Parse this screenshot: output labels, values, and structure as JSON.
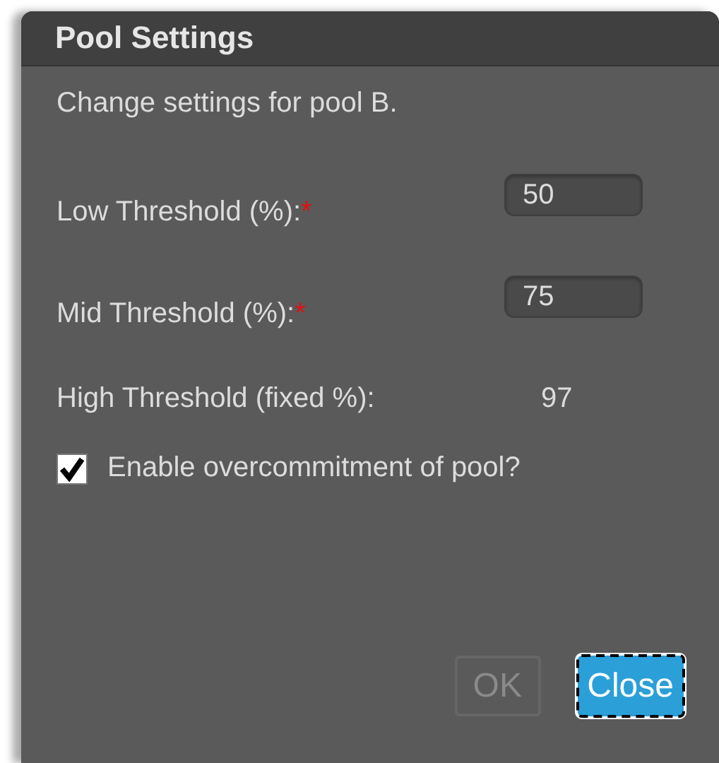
{
  "dialog": {
    "title": "Pool Settings",
    "description": "Change settings for pool B.",
    "fields": [
      {
        "kind": "input",
        "label": "Low Threshold (%):",
        "required_mark": "*",
        "value": "50"
      },
      {
        "kind": "input",
        "label": "Mid Threshold (%):",
        "required_mark": "*",
        "value": "75"
      },
      {
        "kind": "fixed",
        "label": "High Threshold (fixed %):",
        "value": "97"
      }
    ],
    "checkbox": {
      "label": "Enable overcommitment of pool?",
      "checked": true
    },
    "buttons": [
      {
        "label": "OK",
        "disabled": true,
        "focused": false
      },
      {
        "label": "Close",
        "disabled": false,
        "focused": true
      }
    ]
  }
}
